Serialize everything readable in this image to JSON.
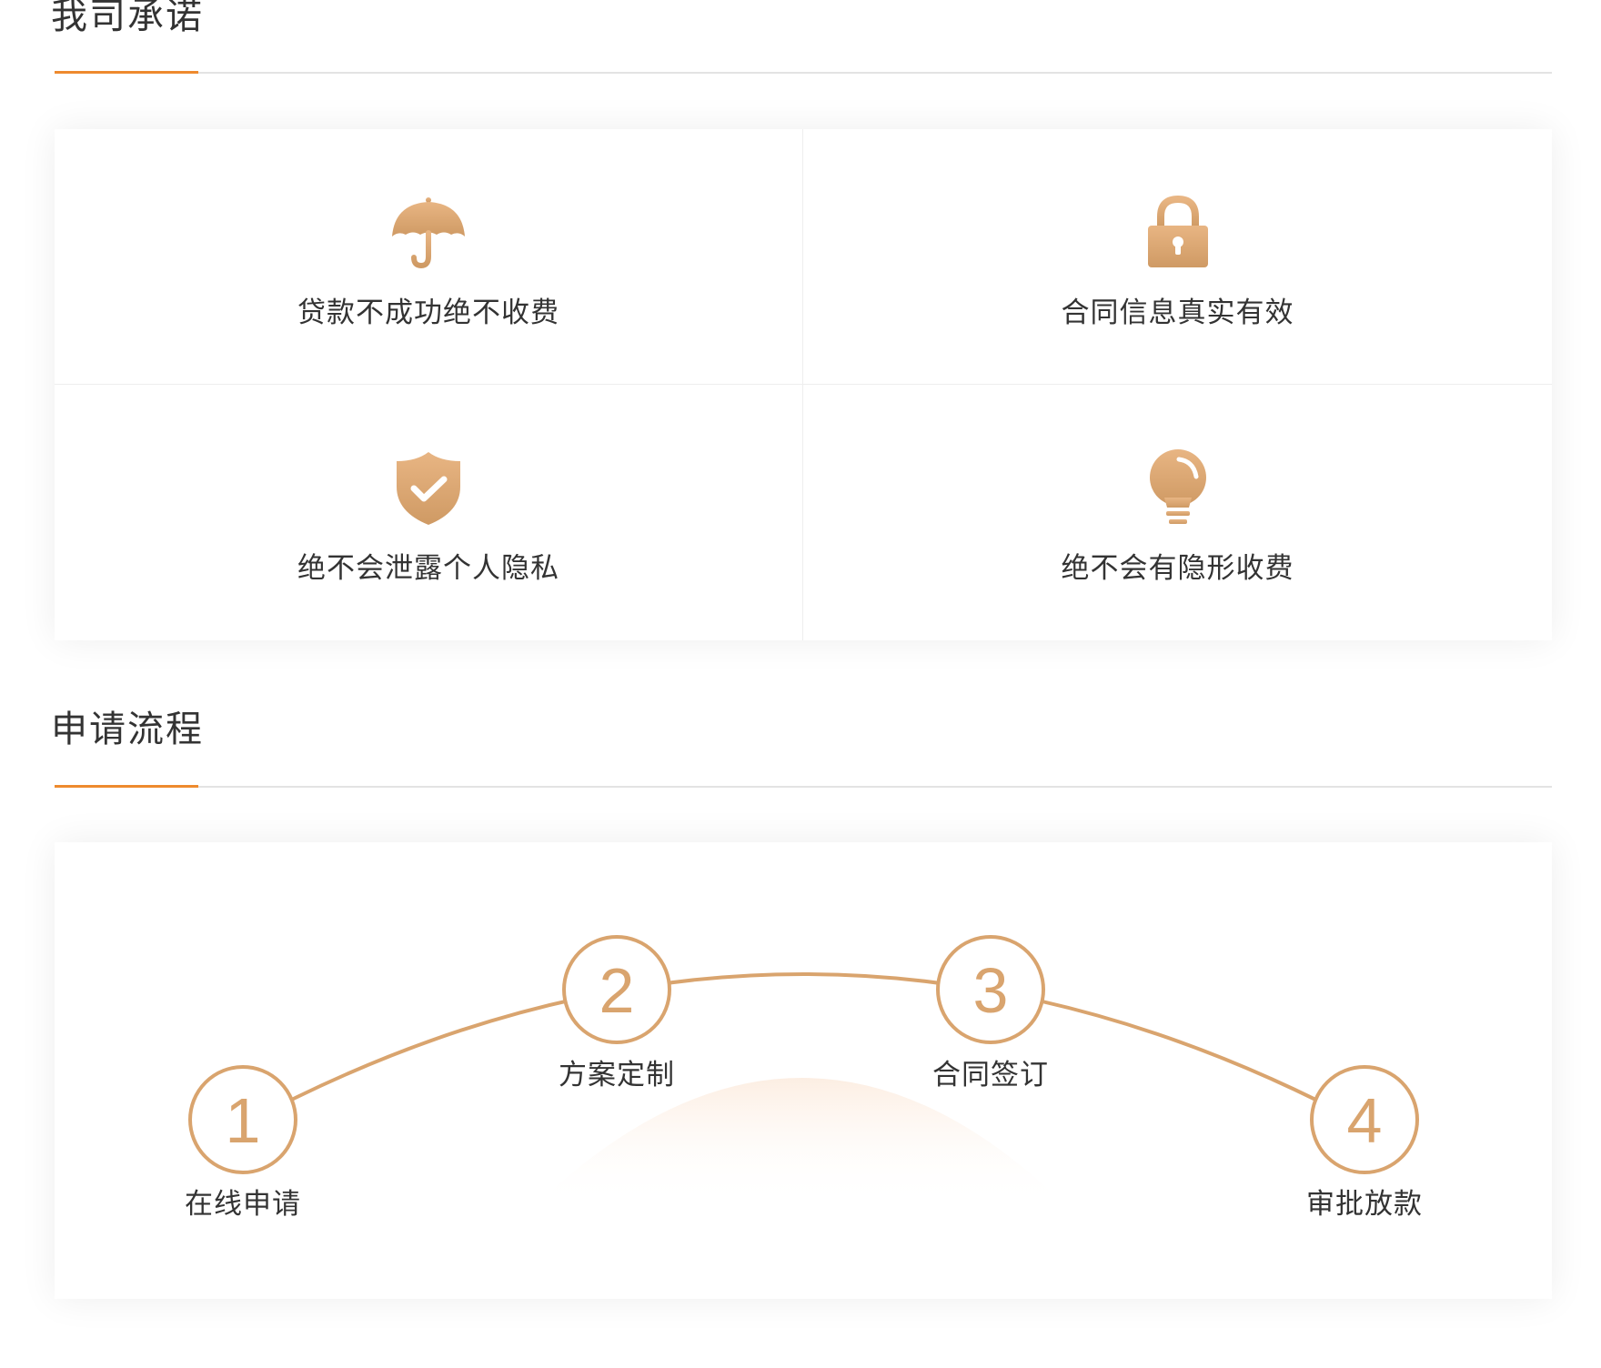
{
  "promise_section": {
    "title": "我司承诺",
    "items": [
      {
        "label": "贷款不成功绝不收费",
        "icon": "umbrella-icon"
      },
      {
        "label": "合同信息真实有效",
        "icon": "lock-icon"
      },
      {
        "label": "绝不会泄露个人隐私",
        "icon": "shield-check-icon"
      },
      {
        "label": "绝不会有隐形收费",
        "icon": "lightbulb-icon"
      }
    ]
  },
  "process_section": {
    "title": "申请流程",
    "steps": [
      {
        "number": "1",
        "label": "在线申请"
      },
      {
        "number": "2",
        "label": "方案定制"
      },
      {
        "number": "3",
        "label": "合同签订"
      },
      {
        "number": "4",
        "label": "审批放款"
      }
    ]
  },
  "colors": {
    "accent": "#ee8a2e",
    "gold": "#d9a46e",
    "text": "#333333",
    "divider": "#e3e3e3"
  }
}
